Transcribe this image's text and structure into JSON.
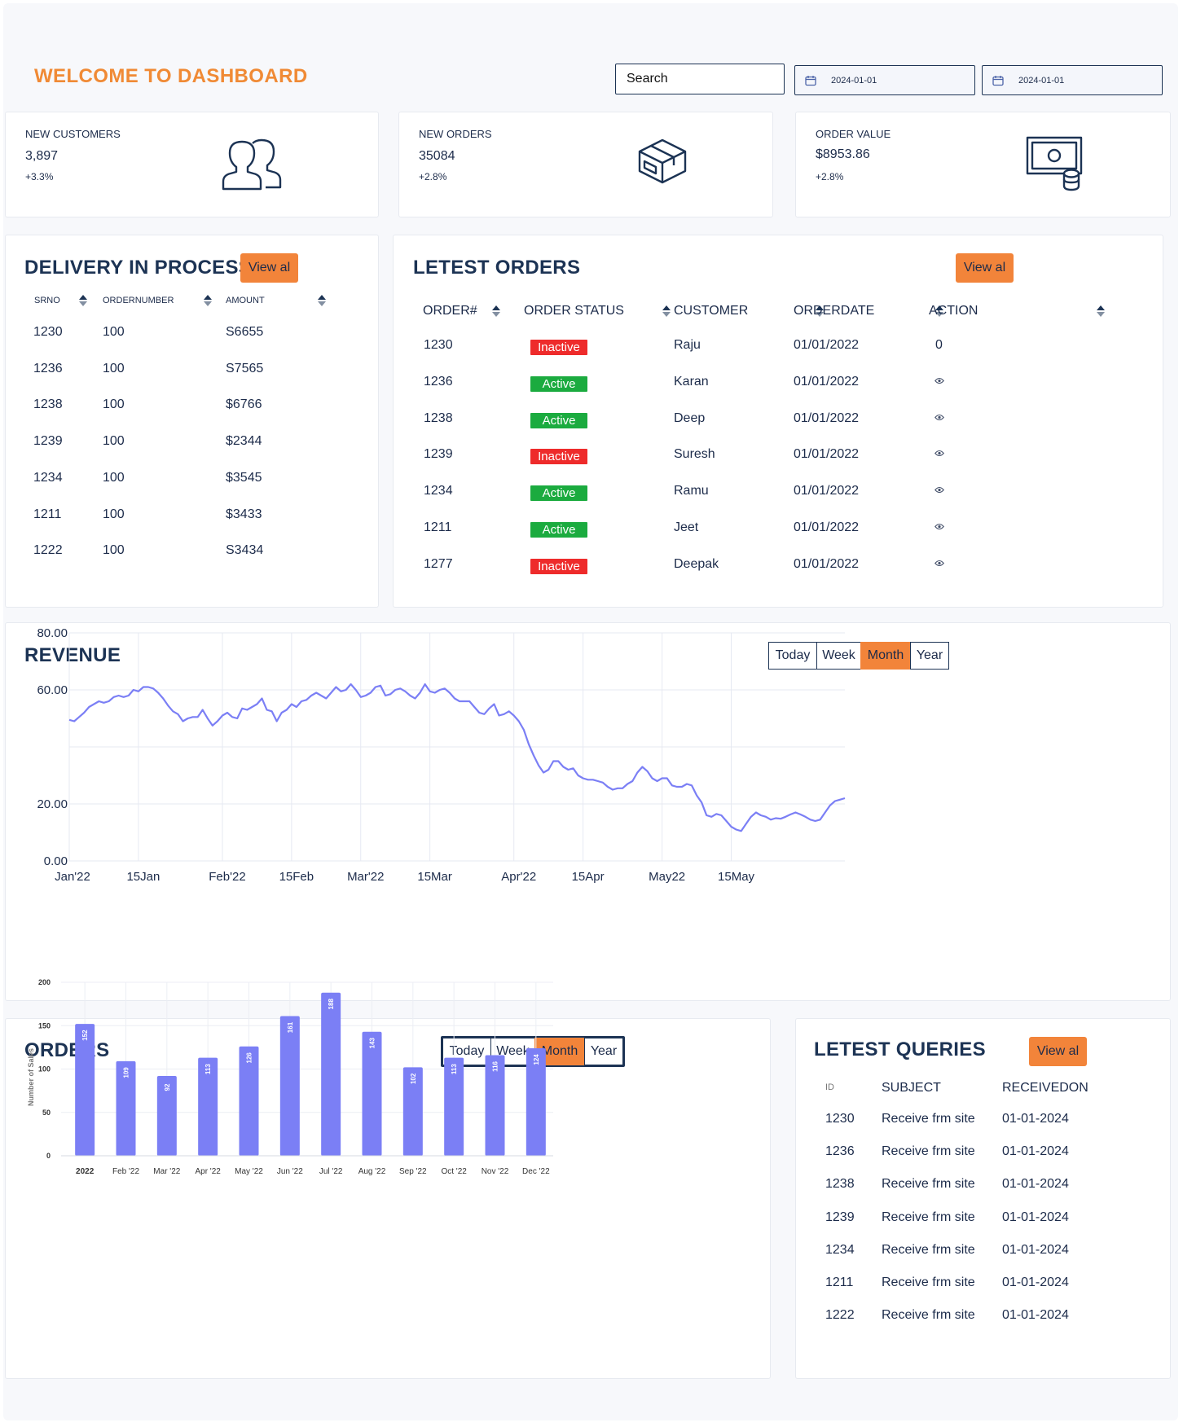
{
  "header": {
    "title": "WELCOME TO DASHBOARD",
    "search_placeholder": "Search",
    "date_from": "2024-01-01",
    "date_to": "2024-01-01"
  },
  "stats": [
    {
      "label": "NEW CUSTOMERS",
      "value": "3,897",
      "change": "+3.3%",
      "icon": "users-icon"
    },
    {
      "label": "NEW ORDERS",
      "value": "35084",
      "change": "+2.8%",
      "icon": "package-icon"
    },
    {
      "label": "ORDER VALUE",
      "value": "$8953.86",
      "change": "+2.8%",
      "icon": "money-icon"
    }
  ],
  "delivery": {
    "title": "DELIVERY IN PROCESS",
    "view_all": "View al",
    "headers": [
      "SRNO",
      "ORDERNUMBER",
      "AMOUNT"
    ],
    "rows": [
      [
        "1230",
        "100",
        "S6655"
      ],
      [
        "1236",
        "100",
        "S7565"
      ],
      [
        "1238",
        "100",
        "$6766"
      ],
      [
        "1239",
        "100",
        "$2344"
      ],
      [
        "1234",
        "100",
        "$3545"
      ],
      [
        "1211",
        "100",
        "$3433"
      ],
      [
        "1222",
        "100",
        "S3434"
      ]
    ]
  },
  "latest_orders": {
    "title": "LETEST ORDERS",
    "view_all": "View al",
    "headers": [
      "ORDER#",
      "ORDER STATUS",
      "CUSTOMER",
      "ORDERDATE",
      "ACTION"
    ],
    "rows": [
      {
        "id": "1230",
        "status": "Inactive",
        "customer": "Raju",
        "date": "01/01/2022",
        "action": "0"
      },
      {
        "id": "1236",
        "status": "Active",
        "customer": "Karan",
        "date": "01/01/2022",
        "action": "eye-icon"
      },
      {
        "id": "1238",
        "status": "Active",
        "customer": "Deep",
        "date": "01/01/2022",
        "action": "eye-icon"
      },
      {
        "id": "1239",
        "status": "Inactive",
        "customer": "Suresh",
        "date": "01/01/2022",
        "action": "eye-icon"
      },
      {
        "id": "1234",
        "status": "Active",
        "customer": "Ramu",
        "date": "01/01/2022",
        "action": "eye-icon"
      },
      {
        "id": "1211",
        "status": "Active",
        "customer": "Jeet",
        "date": "01/01/2022",
        "action": "eye-icon"
      },
      {
        "id": "1277",
        "status": "Inactive",
        "customer": "Deepak",
        "date": "01/01/2022",
        "action": "eye-icon"
      }
    ]
  },
  "revenue": {
    "title": "REVENUE",
    "periods": [
      "Today",
      "Week",
      "Month",
      "Year"
    ],
    "selected_period": "Month"
  },
  "orders": {
    "title": "ORDERS",
    "periods": [
      "Today",
      "Week",
      "Month",
      "Year"
    ],
    "selected_period": "Month"
  },
  "queries": {
    "title": "LETEST QUERIES",
    "view_all": "View al",
    "headers": [
      "ID",
      "SUBJECT",
      "RECEIVEDON"
    ],
    "rows": [
      [
        "1230",
        "Receive frm site",
        "01-01-2024"
      ],
      [
        "1236",
        "Receive frm site",
        "01-01-2024"
      ],
      [
        "1238",
        "Receive frm site",
        "01-01-2024"
      ],
      [
        "1239",
        "Receive frm site",
        "01-01-2024"
      ],
      [
        "1234",
        "Receive frm site",
        "01-01-2024"
      ],
      [
        "1211",
        "Receive frm site",
        "01-01-2024"
      ],
      [
        "1222",
        "Receive frm site",
        "01-01-2024"
      ]
    ]
  },
  "colors": {
    "accent": "#f2843a",
    "title_orange": "#f08a35",
    "navy": "#1c3354",
    "active": "#1bab3f",
    "inactive": "#ee2b2b",
    "series": "#7b7ff5"
  },
  "chart_data": [
    {
      "type": "line",
      "yticks": [
        "80.00",
        "60.00",
        "20.00",
        "0.00"
      ],
      "ylim": [
        0,
        80
      ],
      "xtick_labels": [
        "Jan'22",
        "15Jan",
        "Feb'22",
        "15Feb",
        "Mar'22",
        "15Mar",
        "Apr'22",
        "15Apr",
        "May22",
        "15May"
      ],
      "x": [
        "2022-01-01",
        "2022-01-02",
        "2022-01-03",
        "2022-01-04",
        "2022-01-05",
        "2022-01-06",
        "2022-01-07",
        "2022-01-08",
        "2022-01-09",
        "2022-01-10",
        "2022-01-11",
        "2022-01-12",
        "2022-01-13",
        "2022-01-14",
        "2022-01-15",
        "2022-01-16",
        "2022-01-17",
        "2022-01-18",
        "2022-01-19",
        "2022-01-20",
        "2022-01-21",
        "2022-01-22",
        "2022-01-23",
        "2022-01-24",
        "2022-01-25",
        "2022-01-26",
        "2022-01-27",
        "2022-01-28",
        "2022-01-29",
        "2022-01-30",
        "2022-01-31",
        "2022-02-01",
        "2022-02-02",
        "2022-02-03",
        "2022-02-04",
        "2022-02-05",
        "2022-02-06",
        "2022-02-07",
        "2022-02-08",
        "2022-02-09",
        "2022-02-10",
        "2022-02-11",
        "2022-02-12",
        "2022-02-13",
        "2022-02-14",
        "2022-02-15",
        "2022-02-16",
        "2022-02-17",
        "2022-02-18",
        "2022-02-19",
        "2022-02-20",
        "2022-02-21",
        "2022-02-22",
        "2022-02-23",
        "2022-02-24",
        "2022-02-25",
        "2022-02-26",
        "2022-02-27",
        "2022-02-28",
        "2022-03-01",
        "2022-03-02",
        "2022-03-03",
        "2022-03-04",
        "2022-03-05",
        "2022-03-06",
        "2022-03-07",
        "2022-03-08",
        "2022-03-09",
        "2022-03-10",
        "2022-03-11",
        "2022-03-12",
        "2022-03-13",
        "2022-03-14",
        "2022-03-15",
        "2022-03-16",
        "2022-03-17",
        "2022-03-18",
        "2022-03-19",
        "2022-03-20",
        "2022-03-21",
        "2022-03-22",
        "2022-03-23",
        "2022-03-24",
        "2022-03-25",
        "2022-03-26",
        "2022-03-27",
        "2022-03-28",
        "2022-03-29",
        "2022-03-30",
        "2022-03-31",
        "2022-04-01",
        "2022-04-02",
        "2022-04-03",
        "2022-04-04",
        "2022-04-05",
        "2022-04-06",
        "2022-04-07",
        "2022-04-08",
        "2022-04-09",
        "2022-04-10",
        "2022-04-11",
        "2022-04-12",
        "2022-04-13",
        "2022-04-14",
        "2022-04-15",
        "2022-04-16",
        "2022-04-17",
        "2022-04-18",
        "2022-04-19",
        "2022-04-20",
        "2022-04-21",
        "2022-04-22",
        "2022-04-23",
        "2022-04-24",
        "2022-04-25",
        "2022-04-26",
        "2022-04-27",
        "2022-04-28",
        "2022-04-29",
        "2022-04-30",
        "2022-05-01",
        "2022-05-02",
        "2022-05-03",
        "2022-05-04",
        "2022-05-05",
        "2022-05-06",
        "2022-05-07",
        "2022-05-08",
        "2022-05-09",
        "2022-05-10",
        "2022-05-11",
        "2022-05-12",
        "2022-05-13",
        "2022-05-14",
        "2022-05-15",
        "2022-05-16",
        "2022-05-17",
        "2022-05-18",
        "2022-05-19",
        "2022-05-20",
        "2022-05-21",
        "2022-05-22",
        "2022-05-23",
        "2022-05-24",
        "2022-05-25",
        "2022-05-26",
        "2022-05-27",
        "2022-05-28",
        "2022-05-29",
        "2022-05-30",
        "2022-05-31"
      ],
      "y": [
        49.5,
        49,
        50.5,
        52,
        54,
        55,
        56,
        55.5,
        56,
        57.5,
        58,
        57.5,
        58,
        60,
        59.5,
        61,
        61,
        60.5,
        59,
        57,
        54.5,
        52.5,
        51.5,
        49,
        50,
        50.5,
        50.5,
        53,
        50,
        47.5,
        49,
        51,
        52,
        50.5,
        50,
        53.5,
        53,
        54,
        55,
        57,
        53,
        52.5,
        49,
        52,
        53,
        55,
        54,
        56,
        56.5,
        58,
        59,
        58,
        57,
        59,
        61,
        59.5,
        60,
        62,
        60,
        57.5,
        58,
        59,
        61,
        61.5,
        58,
        58.5,
        60,
        60.5,
        59.5,
        58,
        57,
        59,
        62,
        59.5,
        59,
        60,
        60.5,
        59,
        57,
        56,
        56,
        56,
        54,
        52,
        51.5,
        53.5,
        55,
        51,
        51.5,
        52.5,
        51,
        49,
        46,
        41,
        37,
        33.5,
        31,
        32,
        35,
        35,
        33,
        32,
        32.5,
        30,
        29,
        28.5,
        28.5,
        28,
        27.5,
        26,
        25,
        25.5,
        25.5,
        27,
        28,
        31,
        33,
        31.5,
        29,
        28,
        29,
        29,
        26.5,
        26,
        26,
        27,
        26.5,
        23,
        20.5,
        16,
        15.5,
        16.5,
        16,
        14,
        12,
        11,
        10.5,
        13,
        15.5,
        17,
        16,
        15.5,
        14.5,
        15,
        14.8,
        15.5,
        16.3,
        17,
        16.3,
        15.5,
        14.5,
        14,
        14.5,
        17,
        19.5,
        21,
        21.5,
        22
      ]
    },
    {
      "type": "bar",
      "categories": [
        "2022",
        "Feb '22",
        "Mar '22",
        "Apr '22",
        "May '22",
        "Jun '22",
        "Jul '22",
        "Aug '22",
        "Sep '22",
        "Oct '22",
        "Nov '22",
        "Dec '22"
      ],
      "values": [
        152,
        109,
        92,
        113,
        126,
        161,
        188,
        143,
        102,
        113,
        116,
        124
      ],
      "ylabel": "Number of Sales",
      "yticks": [
        0,
        50,
        100,
        150,
        200
      ],
      "ylim": [
        0,
        200
      ]
    }
  ]
}
